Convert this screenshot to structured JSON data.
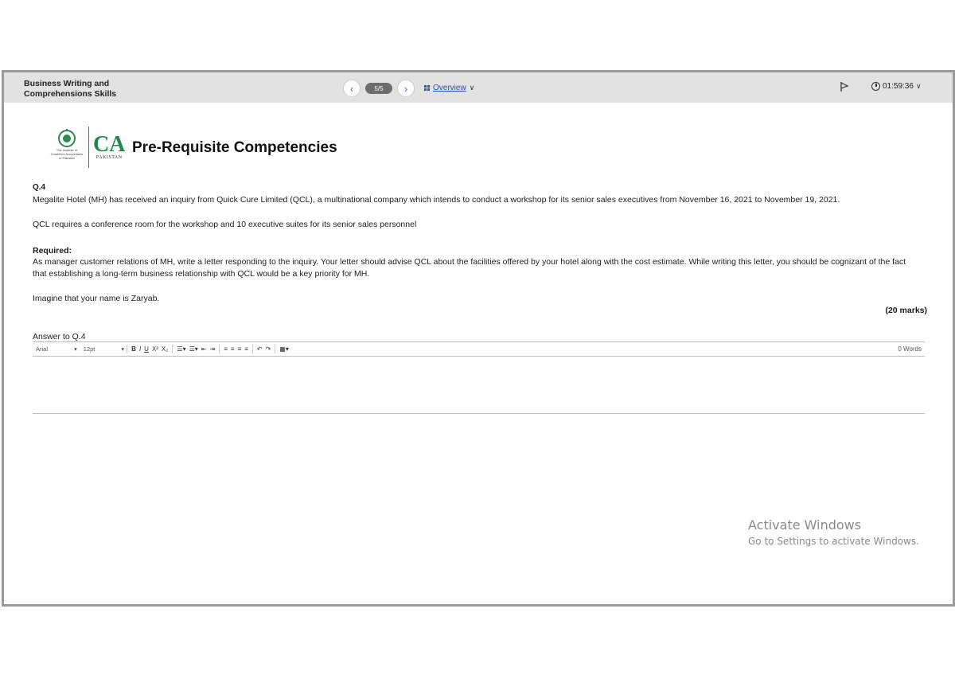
{
  "header": {
    "course_title_line1": "Business Writing and",
    "course_title_line2": "Comprehensions Skills",
    "page_indicator": "5/5",
    "overview_label": "Overview",
    "timer": "01:59:36"
  },
  "logo": {
    "emblem_text_line1": "The Institute of",
    "emblem_text_line2": "Chartered Accountants",
    "emblem_text_line3": "of Pakistan",
    "ca_text": "CA",
    "pakistan_text": "PAKISTAN"
  },
  "page_heading": "Pre-Requisite Competencies",
  "question": {
    "number": "Q.4",
    "para1": "Megalite Hotel (MH) has received an inquiry from Quick Cure Limited (QCL), a multinational company which intends to conduct a workshop for its senior sales executives from November 16, 2021 to November 19, 2021.",
    "para2": "QCL requires a conference room for the workshop and 10 executive suites for its senior sales personnel",
    "required_label": "Required:",
    "required_line1": "As manager customer relations of MH, write a letter responding to the inquiry. Your letter should advise QCL about the facilities offered by your hotel along with the cost estimate. While writing this letter, you should be cognizant of the fact",
    "required_line2": "that establishing a long-term business relationship with QCL would be a key priority for MH.",
    "imagine": "Imagine that your name is Zaryab.",
    "marks": "(20 marks)"
  },
  "answer": {
    "label": "Answer to Q.4",
    "font_family": "Arial",
    "font_size": "12pt",
    "word_count": "0 Words"
  },
  "watermark": {
    "line1": "Activate Windows",
    "line2": "Go to Settings to activate Windows."
  }
}
